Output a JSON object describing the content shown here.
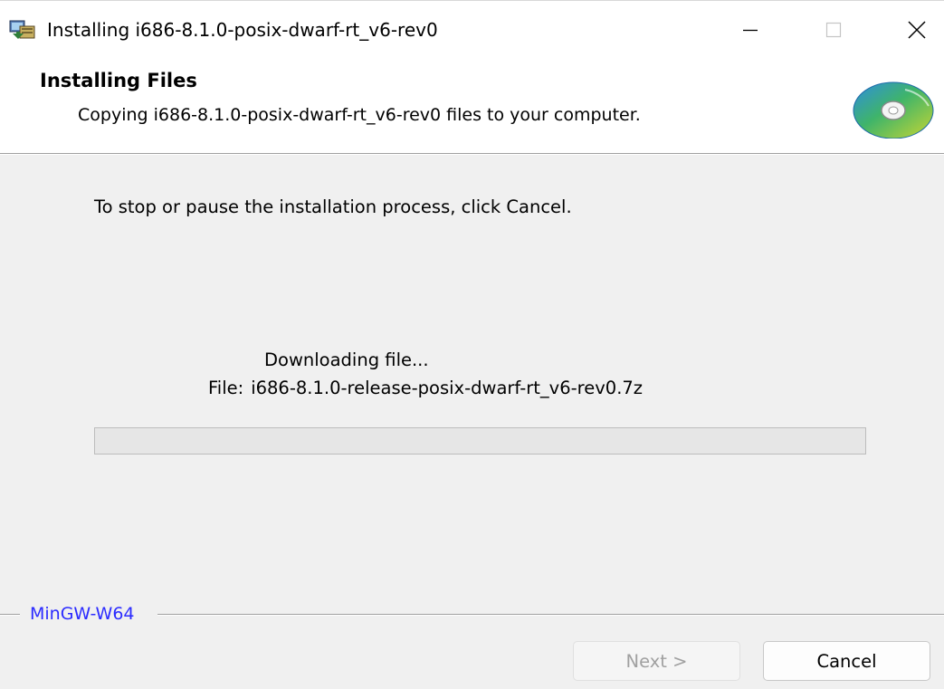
{
  "window": {
    "title": "Installing i686-8.1.0-posix-dwarf-rt_v6-rev0",
    "controls": {
      "minimize": "minimize-icon",
      "maximize": "maximize-icon",
      "close": "close-icon"
    }
  },
  "header": {
    "title": "Installing Files",
    "subtitle": "Copying i686-8.1.0-posix-dwarf-rt_v6-rev0 files to your computer.",
    "icon": "cd-disc-icon"
  },
  "body": {
    "instruction": "To stop or pause the installation process, click Cancel.",
    "status": "Downloading file...",
    "file_label": "File:",
    "file_name": "i686-8.1.0-release-posix-dwarf-rt_v6-rev0.7z",
    "progress": 0
  },
  "footer": {
    "brand": "MinGW-W64",
    "next_label": "Next >",
    "cancel_label": "Cancel"
  },
  "colors": {
    "brand_text": "#2b2bff",
    "progress_fill": "#06b025"
  }
}
